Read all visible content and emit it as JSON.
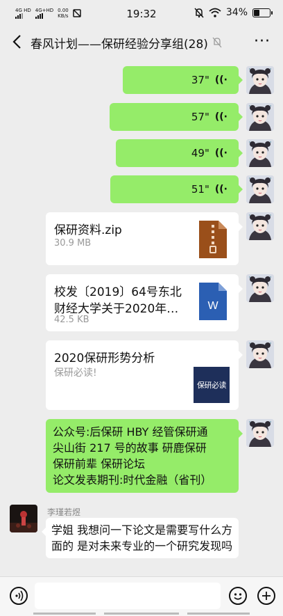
{
  "status_bar": {
    "net1": "4G HD",
    "net2": "4G+HD",
    "speed_value": "0.00",
    "speed_unit": "KB/s",
    "time": "19:32",
    "battery": "34%",
    "battery_level": 0.34
  },
  "header": {
    "title": "春风计划——保研经验分享组(28)",
    "more": "···"
  },
  "voice_messages": [
    {
      "duration": "37\""
    },
    {
      "duration": "57\""
    },
    {
      "duration": "49\""
    },
    {
      "duration": "51\""
    }
  ],
  "file_zip": {
    "name": "保研资料.zip",
    "size": "30.9 MB",
    "icon": "zip-file-icon"
  },
  "file_doc": {
    "name": "校发〔2019〕64号东北财经大学关于2020年…",
    "size": "42.5 KB",
    "icon": "word-file-icon",
    "icon_letter": "W"
  },
  "link_card": {
    "title": "2020保研形势分析",
    "desc": "保研必读!",
    "thumb_text": "保研必读"
  },
  "sent_text": "公众号:后保研 HBY   经管保研通\n尖山街 217 号的故事   研鹿保研\n保研前辈   保研论坛\n论文发表期刊:时代金融（省刊）",
  "incoming": {
    "sender": "李瑾若煜",
    "text": "学姐 我想问一下论文是需要写什么方面的 是对未来专业的一个研究发现吗"
  },
  "colors": {
    "bg": "#ededed",
    "bubble_green": "#95ec69",
    "zip_brown": "#9a4f1a",
    "word_blue": "#2b5fb3",
    "thumb_navy": "#1e2f5a"
  }
}
